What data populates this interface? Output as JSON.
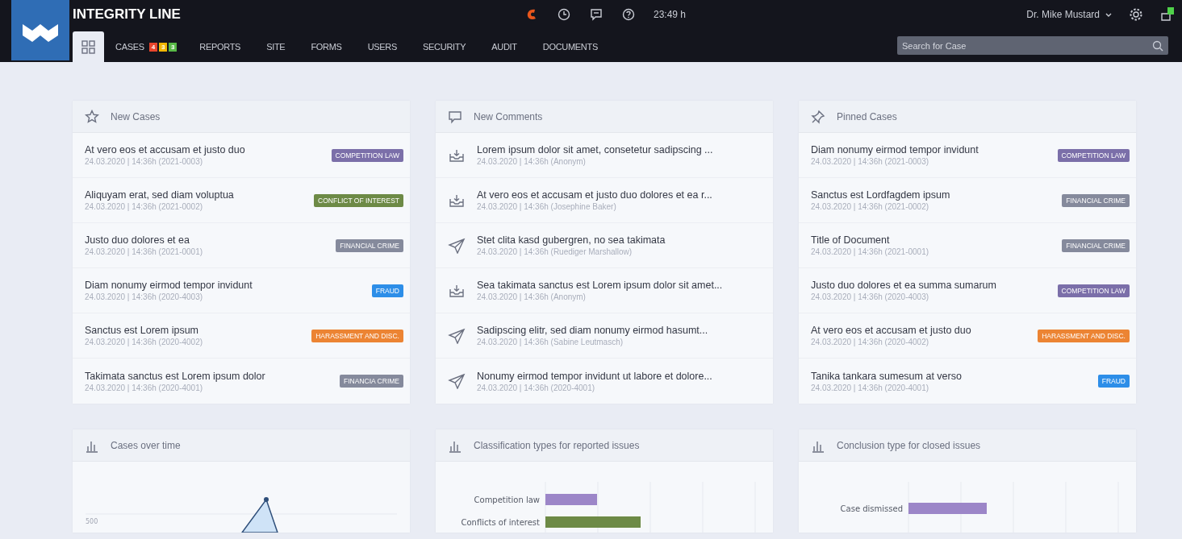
{
  "header": {
    "app_title": "INTEGRITY LINE",
    "time": "23:49 h",
    "user": "Dr. Mike Mustard",
    "search": {
      "placeholder": "Search for Case"
    }
  },
  "nav": [
    {
      "kind": "home",
      "selected": true
    },
    {
      "kind": "text",
      "label": "CASES",
      "selected": false,
      "badges": [
        {
          "text": "4",
          "color": "#e8452c"
        },
        {
          "text": "3",
          "color": "#f2b705"
        },
        {
          "text": "3",
          "color": "#58b947"
        }
      ]
    },
    {
      "kind": "text",
      "label": "REPORTS",
      "selected": false
    },
    {
      "kind": "text",
      "label": "SITE",
      "selected": false
    },
    {
      "kind": "text",
      "label": "FORMS",
      "selected": false
    },
    {
      "kind": "text",
      "label": "USERS",
      "selected": false
    },
    {
      "kind": "text",
      "label": "SECURITY",
      "selected": false
    },
    {
      "kind": "text",
      "label": "AUDIT",
      "selected": false
    },
    {
      "kind": "text",
      "label": "DOCUMENTS",
      "selected": false
    }
  ],
  "panels": [
    {
      "kind": "cases",
      "title": "New Cases",
      "items": [
        {
          "title": "At vero eos et accusam et justo duo",
          "meta": "24.03.2020 | 14:36h (2021-0003)",
          "tag": "COMPETITION LAW",
          "color": "#7b6fa9"
        },
        {
          "title": " Aliquyam erat, sed diam voluptua",
          "meta": "24.03.2020 | 14:36h (2021-0002)",
          "tag": "CONFLICT OF INTEREST",
          "color": "#6d8a46"
        },
        {
          "title": "Justo duo dolores et ea",
          "meta": "24.03.2020 | 14:36h (2021-0001)",
          "tag": "FINANCIAL CRIME",
          "color": "#858a9c"
        },
        {
          "title": "Diam nonumy eirmod tempor invidunt",
          "meta": "24.03.2020 | 14:36h (2020-4003)",
          "tag": "FRAUD",
          "color": "#2d8ee8"
        },
        {
          "title": "Sanctus est Lorem ipsum",
          "meta": "24.03.2020 | 14:36h (2020-4002)",
          "tag": "HARASSMENT AND DISC.",
          "color": "#ec8433"
        },
        {
          "title": "Takimata sanctus est Lorem ipsum dolor",
          "meta": "24.03.2020 | 14:36h (2020-4001)",
          "tag": "FINANCIA CRIME",
          "color": "#858a9c"
        }
      ]
    },
    {
      "kind": "comments",
      "title": "New Comments",
      "items": [
        {
          "kind": "received",
          "title": "Lorem ipsum dolor sit amet, consetetur sadipscing ...",
          "meta": "24.03.2020 | 14:36h (Anonym)"
        },
        {
          "kind": "received",
          "title": "At vero eos et accusam et justo duo dolores et ea r...",
          "meta": "24.03.2020 | 14:36h (Josephine Baker)"
        },
        {
          "kind": "sent",
          "title": "Stet clita kasd gubergren, no sea takimata",
          "meta": "24.03.2020 | 14:36h (Ruediger Marshallow)"
        },
        {
          "kind": "received",
          "title": "Sea takimata sanctus est Lorem ipsum dolor sit amet...",
          "meta": "24.03.2020 | 14:36h (Anonym)"
        },
        {
          "kind": "sent",
          "title": "Sadipscing elitr, sed diam nonumy eirmod hasumt...",
          "meta": "24.03.2020 | 14:36h (Sabine Leutmasch)"
        },
        {
          "kind": "sent",
          "title": "Nonumy eirmod tempor invidunt ut labore et dolore...",
          "meta": "24.03.2020 | 14:36h (2020-4001)"
        }
      ]
    },
    {
      "kind": "pinned",
      "title": "Pinned Cases",
      "items": [
        {
          "title": "Diam nonumy eirmod tempor invidunt",
          "meta": "24.03.2020 | 14:36h (2021-0003)",
          "tag": "COMPETITION LAW",
          "color": "#7b6fa9"
        },
        {
          "title": "Sanctus est Lordfagdem ipsum",
          "meta": "24.03.2020 | 14:36h (2021-0002)",
          "tag": "FINANCIAL CRIME",
          "color": "#858a9c"
        },
        {
          "title": "Title of Document",
          "meta": "24.03.2020 | 14:36h (2021-0001)",
          "tag": "FINANCIAL CRIME",
          "color": "#858a9c"
        },
        {
          "title": "Justo duo dolores et ea summa sumarum",
          "meta": "24.03.2020 | 14:36h (2020-4003)",
          "tag": "COMPETITION LAW",
          "color": "#7b6fa9"
        },
        {
          "title": "At vero eos et accusam et justo duo",
          "meta": "24.03.2020 | 14:36h (2020-4002)",
          "tag": "HARASSMENT AND DISC.",
          "color": "#ec8433"
        },
        {
          "title": "Tanika tankara sumesum at verso",
          "meta": "24.03.2020 | 14:36h (2020-4001)",
          "tag": "FRAUD",
          "color": "#2d8ee8"
        }
      ]
    }
  ],
  "charts": [
    {
      "kind": "line",
      "title": "Cases over time",
      "tick_label": "500"
    },
    {
      "kind": "bar",
      "title": "Classification types for reported issues",
      "labels": [
        "Competition law",
        "Conflicts of interest"
      ]
    },
    {
      "kind": "bar",
      "title": "Conclusion type for closed issues",
      "labels": [
        "Case dismissed"
      ]
    }
  ]
}
